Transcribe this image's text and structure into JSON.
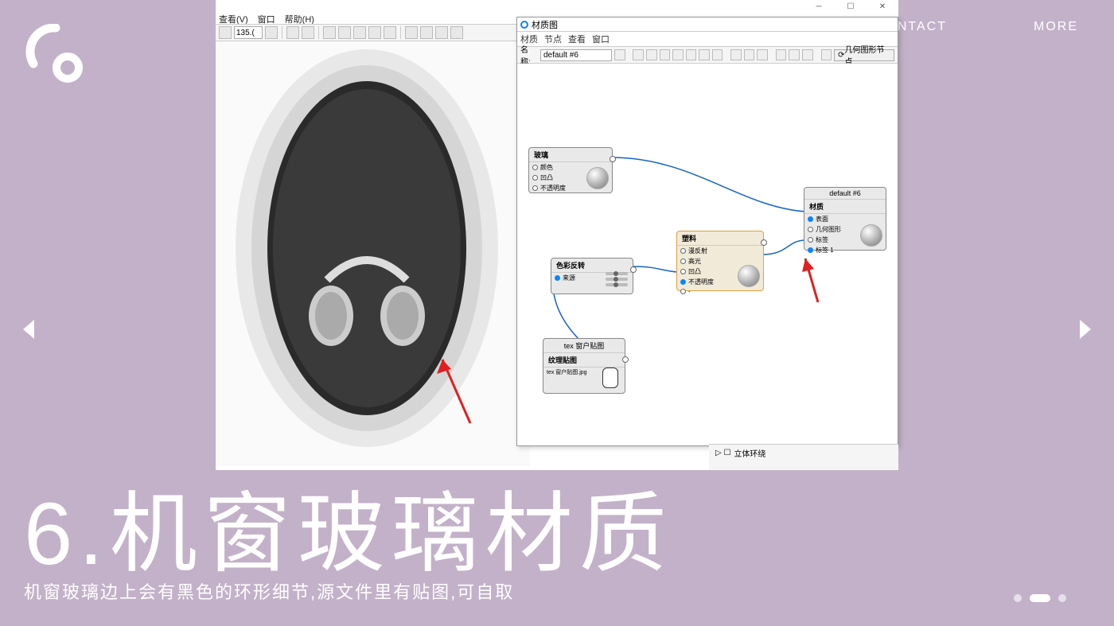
{
  "nav": {
    "contact": "CONTACT",
    "more": "MORE"
  },
  "slide": {
    "title": "6.机窗玻璃材质",
    "subtitle": "机窗玻璃边上会有黑色的环形细节,源文件里有贴图,可自取"
  },
  "app": {
    "menu": {
      "view": "查看(V)",
      "window": "窗口",
      "help": "帮助(H)"
    },
    "zoom": "135.(",
    "tree_item": "立体环绕"
  },
  "material_panel": {
    "title": "材质图",
    "menu": {
      "material": "材质",
      "node": "节点",
      "view": "查看",
      "window": "窗口"
    },
    "name_label": "名称:",
    "name_value": "default #6",
    "geo_btn": "几何图形节点"
  },
  "nodes": {
    "glass": {
      "title": "玻璃",
      "p1": "颜色",
      "p2": "凹凸",
      "p3": "不透明度"
    },
    "invert": {
      "title": "色彩反转",
      "p1": "来源"
    },
    "tex": {
      "header": "tex 窗户贴图",
      "title": "纹理贴图",
      "p1": "tex 窗户贴图.jpg"
    },
    "plastic": {
      "title": "塑料",
      "p1": "漫反射",
      "p2": "高光",
      "p3": "凹凸",
      "p4": "不透明度",
      "p5": "-"
    },
    "out": {
      "header": "default #6",
      "title": "材质",
      "p1": "表面",
      "p2": "几何图形",
      "p3": "标签",
      "p4": "标签 1"
    }
  }
}
